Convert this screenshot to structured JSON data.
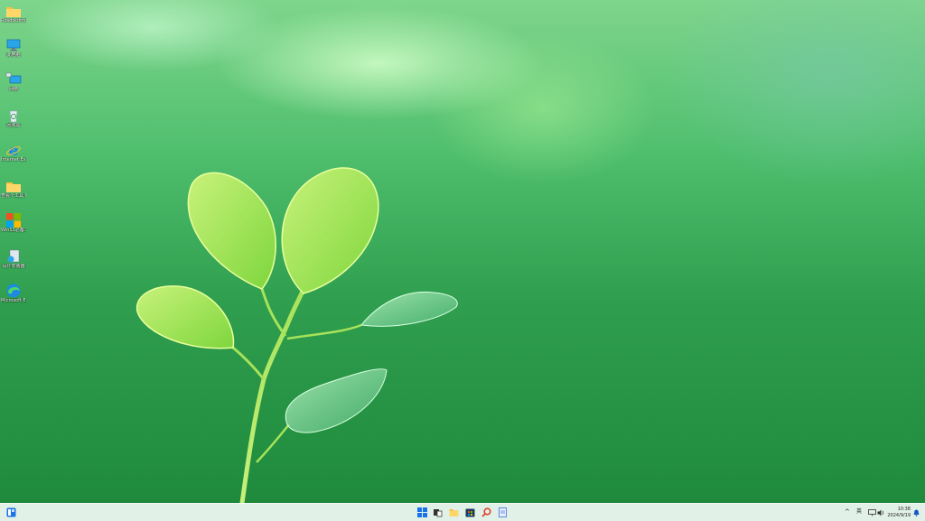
{
  "desktop": {
    "icons": [
      {
        "name": "folder-icon",
        "label": "Rdsdskdmd..."
      },
      {
        "name": "computer-icon",
        "label": "此电脑"
      },
      {
        "name": "network-icon",
        "label": "网络"
      },
      {
        "name": "recycle-bin-icon",
        "label": "回收站"
      },
      {
        "name": "ie-icon",
        "label": "Internet Explorer"
      },
      {
        "name": "folder-icon",
        "label": "查看个工具 箱类型"
      },
      {
        "name": "windows-tools-icon",
        "label": "Win11必备工具箱"
      },
      {
        "name": "installer-icon",
        "label": "设计安装器"
      },
      {
        "name": "edge-icon",
        "label": "Microsoft Edge 浏览器"
      }
    ]
  },
  "taskbar": {
    "clock_time": "10:38",
    "clock_date": "2024/9/19",
    "tray_chevron": "^",
    "tray_lang": "英",
    "colors": {
      "bar": "#e1f0e6",
      "start_blue": "#1a73e8",
      "explorer_yellow": "#f5c242",
      "search_red": "#e0442b"
    }
  }
}
